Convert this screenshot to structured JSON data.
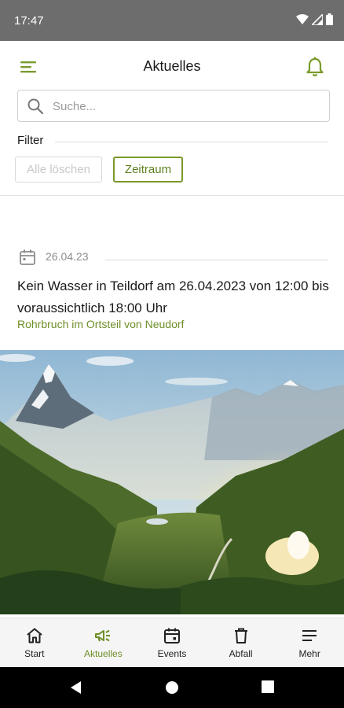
{
  "status_bar": {
    "time": "17:47"
  },
  "header": {
    "title": "Aktuelles"
  },
  "search": {
    "placeholder": "Suche..."
  },
  "filter": {
    "label": "Filter",
    "clear_label": "Alle löschen",
    "zeitraum_label": "Zeitraum"
  },
  "news": [
    {
      "date": "26.04.23",
      "title": "Kein Wasser in Teildorf am 26.04.2023 von 12:00 bis voraussichtlich 18:00 Uhr",
      "subtitle": "Rohrbruch im Ortsteil von Neudorf"
    }
  ],
  "bottom_nav": {
    "items": [
      {
        "label": "Start",
        "icon": "home-icon"
      },
      {
        "label": "Aktuelles",
        "icon": "megaphone-icon",
        "active": true
      },
      {
        "label": "Events",
        "icon": "calendar-icon"
      },
      {
        "label": "Abfall",
        "icon": "trash-icon"
      },
      {
        "label": "Mehr",
        "icon": "menu-icon"
      }
    ]
  },
  "colors": {
    "accent": "#7a9a2c",
    "accent_text": "#6e8f27",
    "status_bar": "#6d6d6d"
  }
}
